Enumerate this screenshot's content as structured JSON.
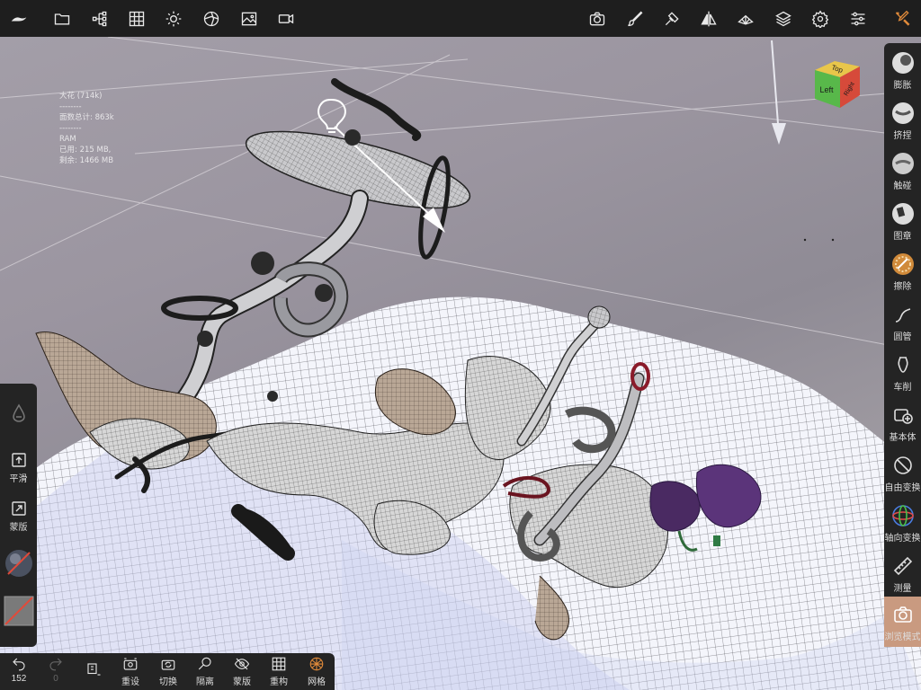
{
  "stats": {
    "object_name": "大花 (714k)",
    "separator1": "--------",
    "total_faces": "面数总计:  863k",
    "separator2": "--------",
    "ram_label": "RAM",
    "ram_used": "已用:  215 MB,",
    "ram_free": "剩余:  1466 MB"
  },
  "viewcube": {
    "top": "Top",
    "left": "Left",
    "right": "Right"
  },
  "top_toolbar": {
    "items": [
      "logo-icon",
      "folder-icon",
      "scene-tree-icon",
      "grid-icon",
      "light-icon",
      "material-icon",
      "image-icon",
      "video-icon",
      "camera-icon",
      "paint-icon",
      "stroke-icon",
      "symmetry-icon",
      "topology-icon",
      "layers-icon",
      "settings-icon",
      "sliders-icon",
      "tools-icon"
    ]
  },
  "right_tools": [
    {
      "label": "膨胀",
      "icon": "inflate-icon"
    },
    {
      "label": "挤捏",
      "icon": "pinch-icon"
    },
    {
      "label": "触碰",
      "icon": "smudge-icon"
    },
    {
      "label": "图章",
      "icon": "stamp-icon"
    },
    {
      "label": "擦除",
      "icon": "erase-icon"
    },
    {
      "label": "圆管",
      "icon": "tube-icon"
    },
    {
      "label": "车削",
      "icon": "lathe-icon"
    },
    {
      "label": "基本体",
      "icon": "primitive-icon"
    },
    {
      "label": "自由变换",
      "icon": "free-transform-icon"
    },
    {
      "label": "轴向变换",
      "icon": "axis-transform-icon"
    },
    {
      "label": "测量",
      "icon": "ruler-icon"
    },
    {
      "label": "浏览模式",
      "icon": "camera-icon"
    }
  ],
  "left_tools": {
    "smooth": "平滑",
    "mask": "蒙版"
  },
  "bottom_bar": {
    "undo_count": "152",
    "redo_count": "0",
    "reset": "重设",
    "switch": "切换",
    "isolate": "隔离",
    "mask": "蒙版",
    "remesh": "重构",
    "wireframe": "网格"
  },
  "colors": {
    "accent": "#c99a80",
    "toolbar_bg": "#1e1e1e",
    "panel_bg": "#242424",
    "cube_top": "#e8c64a",
    "cube_left": "#58b84a",
    "cube_right": "#d64a3a"
  }
}
